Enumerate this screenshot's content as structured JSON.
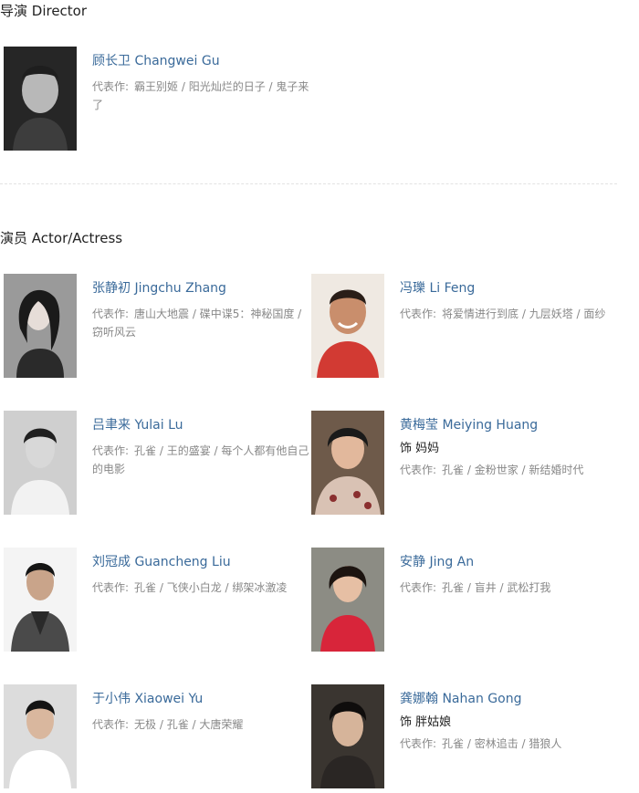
{
  "director_section": {
    "title": "导演 Director",
    "people": [
      {
        "name": "顾长卫 Changwei Gu",
        "works_label": "代表作:",
        "works": "霸王别姬 / 阳光灿烂的日子 / 鬼子来了"
      }
    ]
  },
  "actor_section": {
    "title": "演员 Actor/Actress",
    "people": [
      {
        "name": "张静初 Jingchu Zhang",
        "works_label": "代表作:",
        "works": "唐山大地震 / 碟中谍5：神秘国度 / 窃听风云"
      },
      {
        "name": "冯瓅 Li Feng",
        "works_label": "代表作:",
        "works": "将爱情进行到底 / 九层妖塔 / 面纱"
      },
      {
        "name": "吕聿来 Yulai Lu",
        "works_label": "代表作:",
        "works": "孔雀 / 王的盛宴 / 每个人都有他自己的电影"
      },
      {
        "name": "黄梅莹 Meiying Huang",
        "role": "饰 妈妈",
        "works_label": "代表作:",
        "works": "孔雀 / 金粉世家 / 新结婚时代"
      },
      {
        "name": "刘冠成 Guancheng Liu",
        "works_label": "代表作:",
        "works": "孔雀 / 飞侠小白龙 / 绑架冰激凌"
      },
      {
        "name": "安静 Jing An",
        "works_label": "代表作:",
        "works": "孔雀 / 盲井 / 武松打我"
      },
      {
        "name": "于小伟 Xiaowei Yu",
        "works_label": "代表作:",
        "works": "无极 / 孔雀 / 大唐荣耀"
      },
      {
        "name": "龚娜翰 Nahan Gong",
        "role": "饰 胖姑娘",
        "works_label": "代表作:",
        "works": "孔雀 / 密林追击 / 猎狼人"
      }
    ]
  }
}
